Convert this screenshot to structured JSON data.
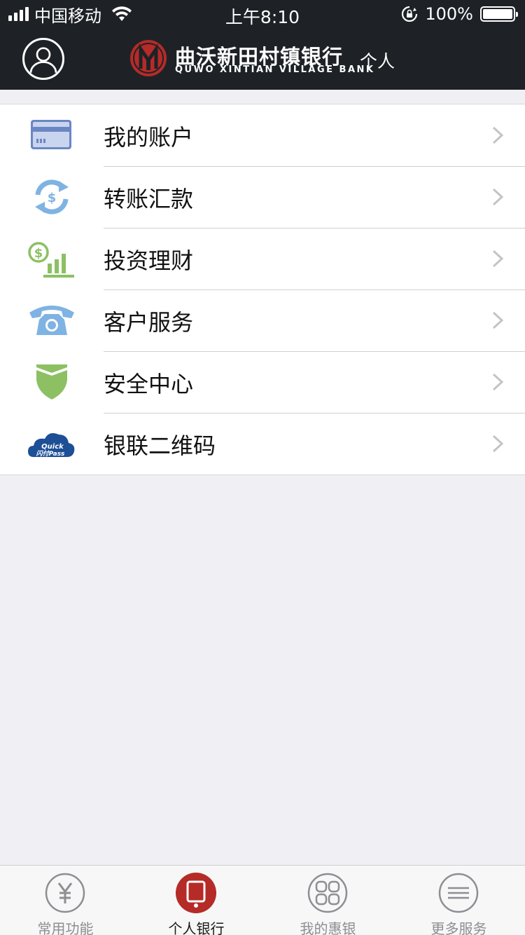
{
  "status_bar": {
    "carrier": "中国移动",
    "time": "上午8:10",
    "battery_percent": "100%",
    "battery_level": 1.0
  },
  "nav": {
    "bank_name_cn": "曲沃新田村镇银行",
    "bank_name_en": "QUWO XINTIAN VILLAGE BANK",
    "section": "个人"
  },
  "menu": {
    "items": [
      {
        "label": "我的账户",
        "icon": "bank-card-icon"
      },
      {
        "label": "转账汇款",
        "icon": "transfer-icon"
      },
      {
        "label": "投资理财",
        "icon": "investment-icon"
      },
      {
        "label": "客户服务",
        "icon": "telephone-icon"
      },
      {
        "label": "安全中心",
        "icon": "shield-icon"
      },
      {
        "label": "银联二维码",
        "icon": "quickpass-icon"
      }
    ],
    "quickpass_logo_text": "Quick 闪付Pass"
  },
  "tabbar": {
    "tabs": [
      {
        "label": "常用功能",
        "icon": "yuan-icon",
        "active": false
      },
      {
        "label": "个人银行",
        "icon": "phone-icon",
        "active": true
      },
      {
        "label": "我的惠银",
        "icon": "grid-icon",
        "active": false
      },
      {
        "label": "更多服务",
        "icon": "menu-lines-icon",
        "active": false
      }
    ]
  },
  "colors": {
    "header_bg": "#1e2227",
    "brand_red": "#b52b27",
    "page_bg": "#efeff4",
    "card_blue": "#6b86c4",
    "transfer_blue": "#7fb3e3",
    "invest_green": "#8cc063",
    "phone_blue": "#7fb3e3",
    "shield_green": "#8cc063",
    "quickpass_blue": "#1d4f96"
  }
}
